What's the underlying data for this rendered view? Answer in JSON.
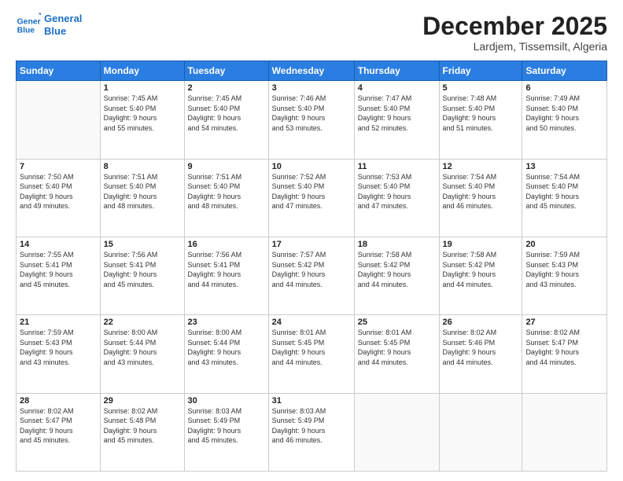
{
  "logo": {
    "line1": "General",
    "line2": "Blue"
  },
  "header": {
    "title": "December 2025",
    "subtitle": "Lardjem, Tissemsilt, Algeria"
  },
  "weekdays": [
    "Sunday",
    "Monday",
    "Tuesday",
    "Wednesday",
    "Thursday",
    "Friday",
    "Saturday"
  ],
  "weeks": [
    [
      {
        "day": "",
        "info": ""
      },
      {
        "day": "1",
        "info": "Sunrise: 7:45 AM\nSunset: 5:40 PM\nDaylight: 9 hours\nand 55 minutes."
      },
      {
        "day": "2",
        "info": "Sunrise: 7:45 AM\nSunset: 5:40 PM\nDaylight: 9 hours\nand 54 minutes."
      },
      {
        "day": "3",
        "info": "Sunrise: 7:46 AM\nSunset: 5:40 PM\nDaylight: 9 hours\nand 53 minutes."
      },
      {
        "day": "4",
        "info": "Sunrise: 7:47 AM\nSunset: 5:40 PM\nDaylight: 9 hours\nand 52 minutes."
      },
      {
        "day": "5",
        "info": "Sunrise: 7:48 AM\nSunset: 5:40 PM\nDaylight: 9 hours\nand 51 minutes."
      },
      {
        "day": "6",
        "info": "Sunrise: 7:49 AM\nSunset: 5:40 PM\nDaylight: 9 hours\nand 50 minutes."
      }
    ],
    [
      {
        "day": "7",
        "info": "Sunrise: 7:50 AM\nSunset: 5:40 PM\nDaylight: 9 hours\nand 49 minutes."
      },
      {
        "day": "8",
        "info": "Sunrise: 7:51 AM\nSunset: 5:40 PM\nDaylight: 9 hours\nand 48 minutes."
      },
      {
        "day": "9",
        "info": "Sunrise: 7:51 AM\nSunset: 5:40 PM\nDaylight: 9 hours\nand 48 minutes."
      },
      {
        "day": "10",
        "info": "Sunrise: 7:52 AM\nSunset: 5:40 PM\nDaylight: 9 hours\nand 47 minutes."
      },
      {
        "day": "11",
        "info": "Sunrise: 7:53 AM\nSunset: 5:40 PM\nDaylight: 9 hours\nand 47 minutes."
      },
      {
        "day": "12",
        "info": "Sunrise: 7:54 AM\nSunset: 5:40 PM\nDaylight: 9 hours\nand 46 minutes."
      },
      {
        "day": "13",
        "info": "Sunrise: 7:54 AM\nSunset: 5:40 PM\nDaylight: 9 hours\nand 45 minutes."
      }
    ],
    [
      {
        "day": "14",
        "info": "Sunrise: 7:55 AM\nSunset: 5:41 PM\nDaylight: 9 hours\nand 45 minutes."
      },
      {
        "day": "15",
        "info": "Sunrise: 7:56 AM\nSunset: 5:41 PM\nDaylight: 9 hours\nand 45 minutes."
      },
      {
        "day": "16",
        "info": "Sunrise: 7:56 AM\nSunset: 5:41 PM\nDaylight: 9 hours\nand 44 minutes."
      },
      {
        "day": "17",
        "info": "Sunrise: 7:57 AM\nSunset: 5:42 PM\nDaylight: 9 hours\nand 44 minutes."
      },
      {
        "day": "18",
        "info": "Sunrise: 7:58 AM\nSunset: 5:42 PM\nDaylight: 9 hours\nand 44 minutes."
      },
      {
        "day": "19",
        "info": "Sunrise: 7:58 AM\nSunset: 5:42 PM\nDaylight: 9 hours\nand 44 minutes."
      },
      {
        "day": "20",
        "info": "Sunrise: 7:59 AM\nSunset: 5:43 PM\nDaylight: 9 hours\nand 43 minutes."
      }
    ],
    [
      {
        "day": "21",
        "info": "Sunrise: 7:59 AM\nSunset: 5:43 PM\nDaylight: 9 hours\nand 43 minutes."
      },
      {
        "day": "22",
        "info": "Sunrise: 8:00 AM\nSunset: 5:44 PM\nDaylight: 9 hours\nand 43 minutes."
      },
      {
        "day": "23",
        "info": "Sunrise: 8:00 AM\nSunset: 5:44 PM\nDaylight: 9 hours\nand 43 minutes."
      },
      {
        "day": "24",
        "info": "Sunrise: 8:01 AM\nSunset: 5:45 PM\nDaylight: 9 hours\nand 44 minutes."
      },
      {
        "day": "25",
        "info": "Sunrise: 8:01 AM\nSunset: 5:45 PM\nDaylight: 9 hours\nand 44 minutes."
      },
      {
        "day": "26",
        "info": "Sunrise: 8:02 AM\nSunset: 5:46 PM\nDaylight: 9 hours\nand 44 minutes."
      },
      {
        "day": "27",
        "info": "Sunrise: 8:02 AM\nSunset: 5:47 PM\nDaylight: 9 hours\nand 44 minutes."
      }
    ],
    [
      {
        "day": "28",
        "info": "Sunrise: 8:02 AM\nSunset: 5:47 PM\nDaylight: 9 hours\nand 45 minutes."
      },
      {
        "day": "29",
        "info": "Sunrise: 8:02 AM\nSunset: 5:48 PM\nDaylight: 9 hours\nand 45 minutes."
      },
      {
        "day": "30",
        "info": "Sunrise: 8:03 AM\nSunset: 5:49 PM\nDaylight: 9 hours\nand 45 minutes."
      },
      {
        "day": "31",
        "info": "Sunrise: 8:03 AM\nSunset: 5:49 PM\nDaylight: 9 hours\nand 46 minutes."
      },
      {
        "day": "",
        "info": ""
      },
      {
        "day": "",
        "info": ""
      },
      {
        "day": "",
        "info": ""
      }
    ]
  ]
}
